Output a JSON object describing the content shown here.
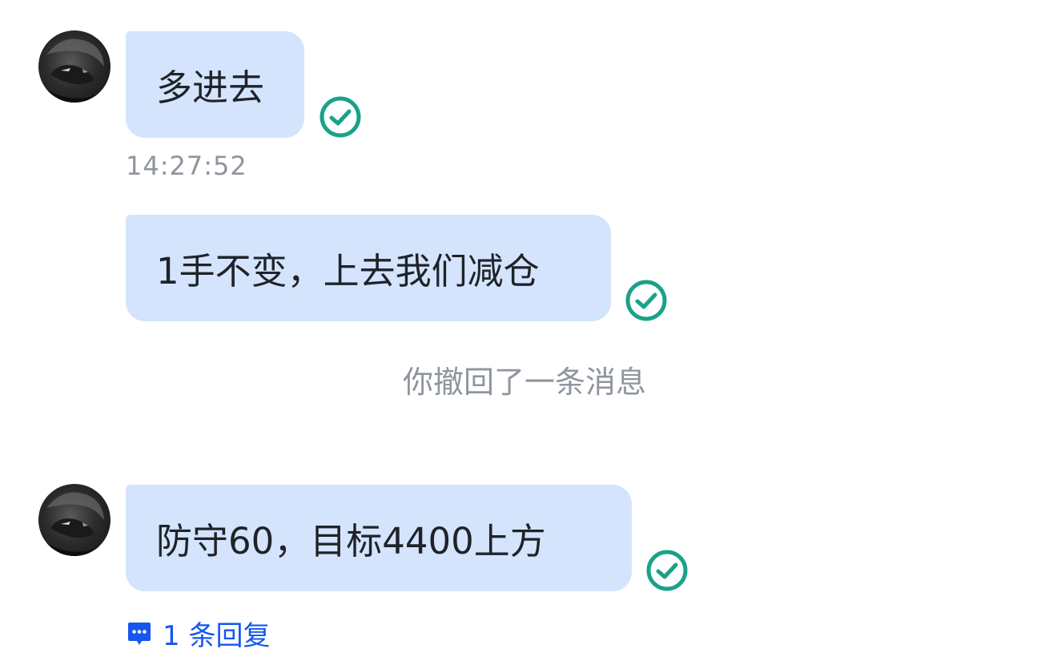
{
  "messages": [
    {
      "text": "多进去",
      "timestamp": "14:27:52",
      "status_icon": "read-check-icon",
      "has_avatar": true
    },
    {
      "text": "1手不变，上去我们减仓",
      "status_icon": "read-check-icon",
      "has_avatar": false
    },
    {
      "text": "防守60，目标4400上方",
      "status_icon": "read-check-icon",
      "has_avatar": true,
      "reply_count_label": "1 条回复"
    }
  ],
  "recall_notice": "你撤回了一条消息",
  "colors": {
    "bubble_bg": "#d4e4fd",
    "read_check": "#1aa189",
    "timestamp": "#8f959e",
    "reply_link": "#1456f0",
    "text": "#1f2329"
  },
  "icons": {
    "avatar": "avatar-dark-anime",
    "read_status": "read-check-icon",
    "reply": "reply-bubble-icon"
  }
}
